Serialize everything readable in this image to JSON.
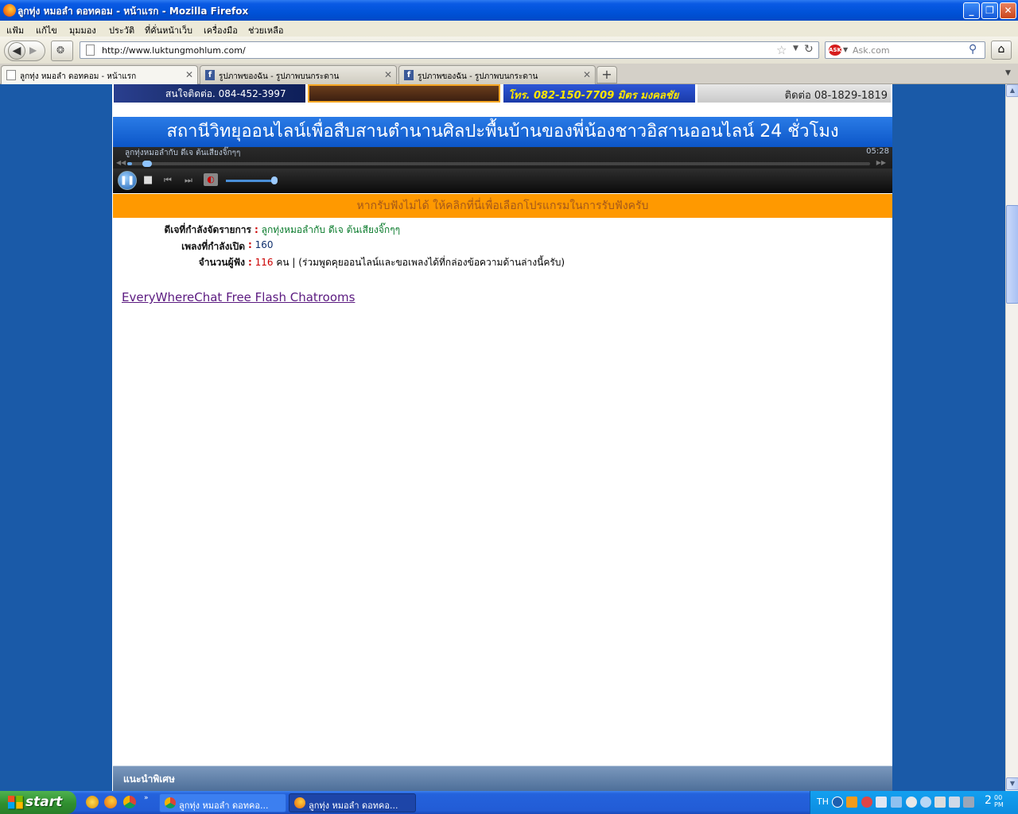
{
  "window": {
    "title": "ลูกทุ่ง หมอลำ ดอทคอม - หน้าแรก - Mozilla Firefox",
    "controls": {
      "minimize": "_",
      "restore": "❐",
      "close": "✕"
    }
  },
  "menu": [
    "แฟ้ม",
    "แก้ไข",
    "มุมมอง",
    "ประวัติ",
    "ที่คั่นหน้าเว็บ",
    "เครื่องมือ",
    "ช่วยเหลือ"
  ],
  "navbar": {
    "url": "http://www.luktungmohlum.com/",
    "search_placeholder": "Ask.com",
    "search_logo": "ASK"
  },
  "tabs": [
    {
      "label": "ลูกทุ่ง หมอลำ ดอทคอม - หน้าแรก",
      "icon": "page-icon",
      "active": true
    },
    {
      "label": "รูปภาพของฉัน - รูปภาพบนกระดาน",
      "icon": "facebook-icon",
      "active": false
    },
    {
      "label": "รูปภาพของฉัน - รูปภาพบนกระดาน",
      "icon": "facebook-icon",
      "active": false
    }
  ],
  "banners": {
    "left_text": "สนใจติดต่อ. 084-452-3997",
    "right_mid_text": "โทร. 082-150-7709 มิตร มงคลชัย",
    "right_text": "ติดต่อ 08-1829-1819"
  },
  "station_title": "สถานีวิทยุออนไลน์เพื่อสืบสานตำนานศิลปะพื้นบ้านของพี่น้องชาวอิสานออนไลน์ 24 ชั่วโมง",
  "player": {
    "now_playing": "ลูกทุ่งหมอลำกับ ดีเจ ต้นเสียงจิ๊กๆๆ",
    "time": "05:28",
    "seek_fraction": 0.005,
    "volume_fraction": 1.0
  },
  "help_bar": "หากรับฟังไม่ได้ ให้คลิกที่นี่เพื่อเลือกโปรแกรมในการรับฟังครับ",
  "info": {
    "dj_label": "ดีเจที่กำลังจัดรายการ",
    "dj_value": "ลูกทุ่งหมอลำกับ ดีเจ ต้นเสียงจิ๊กๆๆ",
    "song_label": "เพลงที่กำลังเปิด",
    "song_value": "160",
    "listeners_label": "จำนวนผู้ฟัง",
    "listeners_value": "116",
    "listeners_suffix": "คน | (ร่วมพูดคุยออนไลน์และขอเพลงได้ที่กล่องข้อความด้านล่างนี้ครับ)",
    "colon": ":"
  },
  "chat_link": "EveryWhereChat Free Flash Chatrooms",
  "recommend_header": "แนะนำพิเศษ",
  "taskbar": {
    "start_label": "start",
    "items": [
      {
        "label": "ลูกทุ่ง หมอลำ ดอทคอ...",
        "icon": "chrome-icon",
        "active": false
      },
      {
        "label": "ลูกทุ่ง หมอลำ ดอทคอ...",
        "icon": "firefox-icon",
        "active": true
      }
    ],
    "lang": "TH",
    "clock_time": "2",
    "clock_minutes": "00",
    "clock_ampm": "PM"
  }
}
